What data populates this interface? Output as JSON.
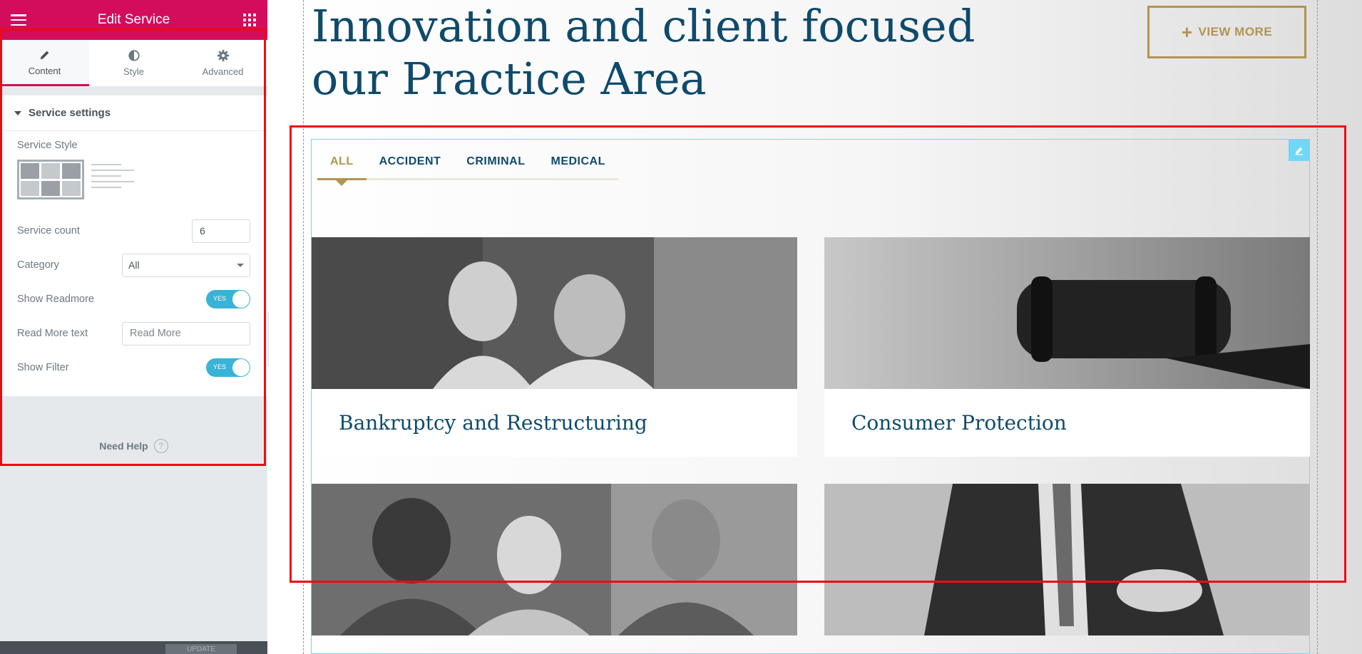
{
  "panel": {
    "header_title": "Edit Service",
    "tabs": [
      {
        "label": "Content",
        "icon": "pencil-icon"
      },
      {
        "label": "Style",
        "icon": "half-circle-icon"
      },
      {
        "label": "Advanced",
        "icon": "gear-icon"
      }
    ],
    "section_title": "Service settings",
    "controls": {
      "service_style_label": "Service Style",
      "service_count_label": "Service count",
      "service_count_value": "6",
      "category_label": "Category",
      "category_value": "All",
      "show_readmore_label": "Show Readmore",
      "show_readmore_value": "YES",
      "read_more_text_label": "Read More text",
      "read_more_text_value": "Read More",
      "show_filter_label": "Show Filter",
      "show_filter_value": "YES"
    },
    "need_help": "Need Help",
    "footer_button": "UPDATE"
  },
  "preview": {
    "headline_line1": "Innovation and client focused",
    "headline_line2": "our Practice Area",
    "view_more_label": "VIEW MORE",
    "filters": [
      "ALL",
      "ACCIDENT",
      "CRIMINAL",
      "MEDICAL"
    ],
    "cards": [
      {
        "title": "Bankruptcy and Restructuring"
      },
      {
        "title": "Consumer Protection"
      },
      {
        "title": ""
      },
      {
        "title": ""
      }
    ]
  },
  "colors": {
    "panel_accent": "#d30c5c",
    "brand_navy": "#0f4a6b",
    "brand_gold": "#b29450",
    "edit_frame": "#71d7f7",
    "highlight_box": "#ec0b14"
  }
}
